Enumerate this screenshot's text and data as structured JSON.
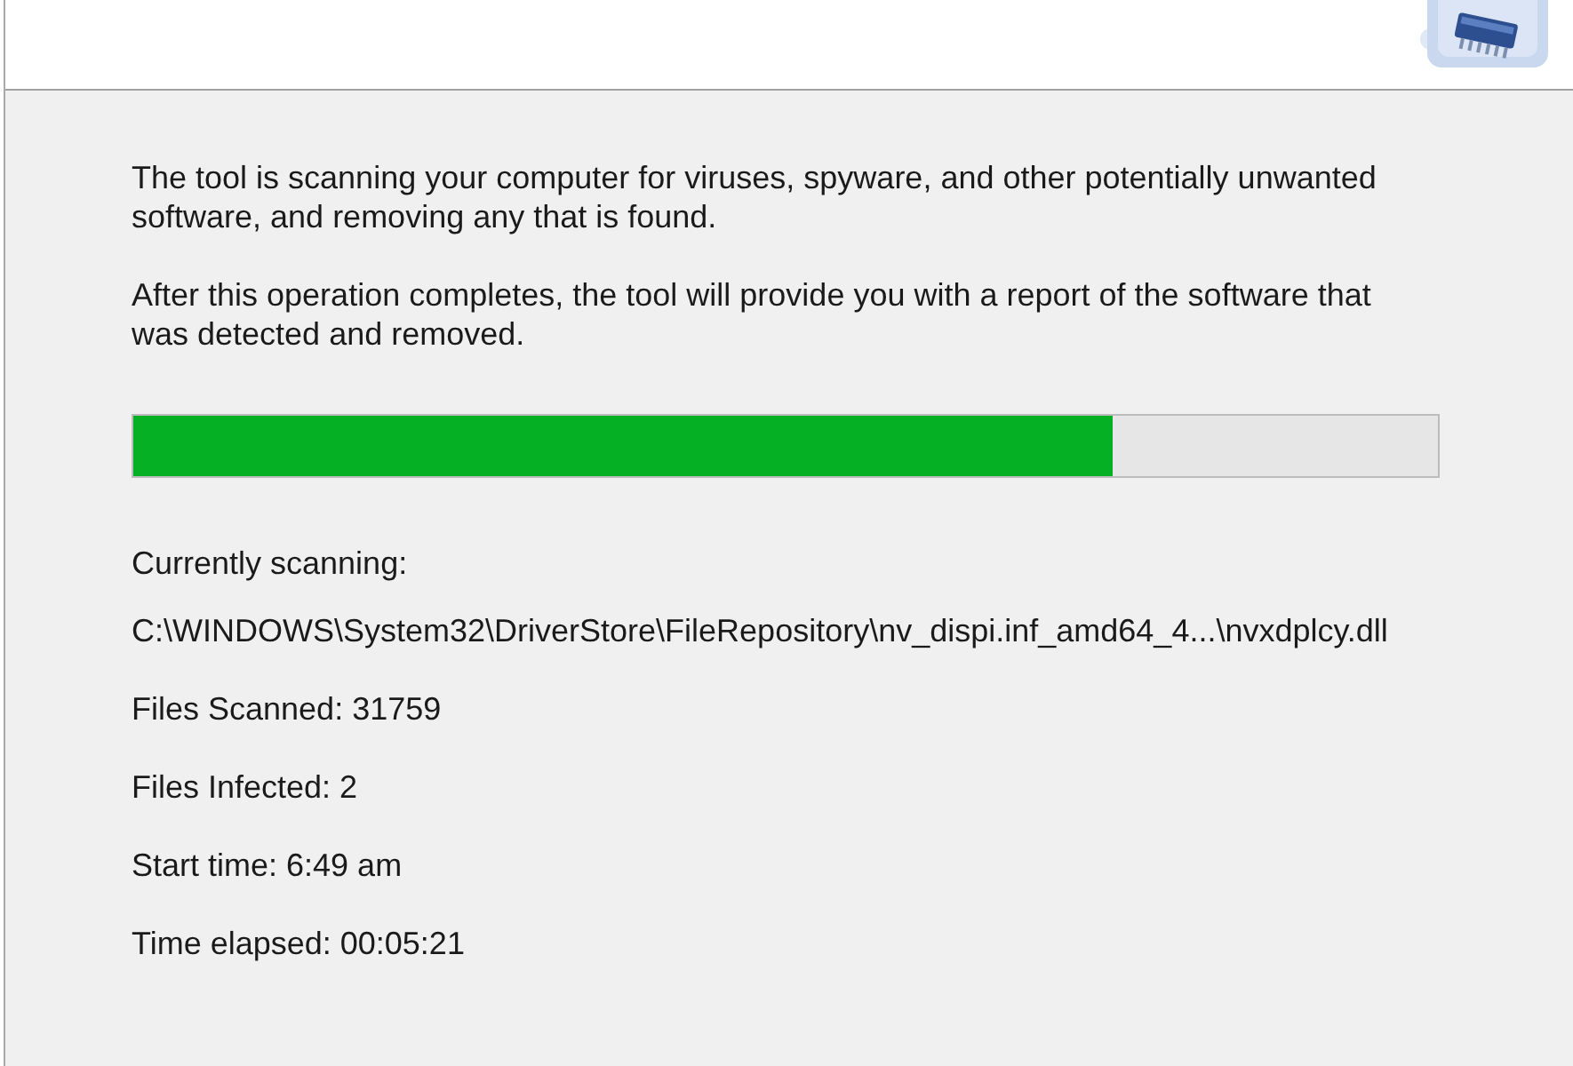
{
  "description": [
    "The tool is scanning your computer for viruses, spyware, and other potentially unwanted software, and removing any that is found.",
    "After this operation completes, the tool will provide you with a report of the software that was detected and removed."
  ],
  "progress": {
    "level": 0.75
  },
  "current": {
    "label": "Currently scanning:",
    "path": "C:\\WINDOWS\\System32\\DriverStore\\FileRepository\\nv_dispi.inf_amd64_4...\\nvxdplcy.dll"
  },
  "stats": [
    "Files Scanned: 31759",
    "Files Infected: 2",
    "Start time: 6:49 am",
    "Time elapsed: 00:05:21"
  ]
}
